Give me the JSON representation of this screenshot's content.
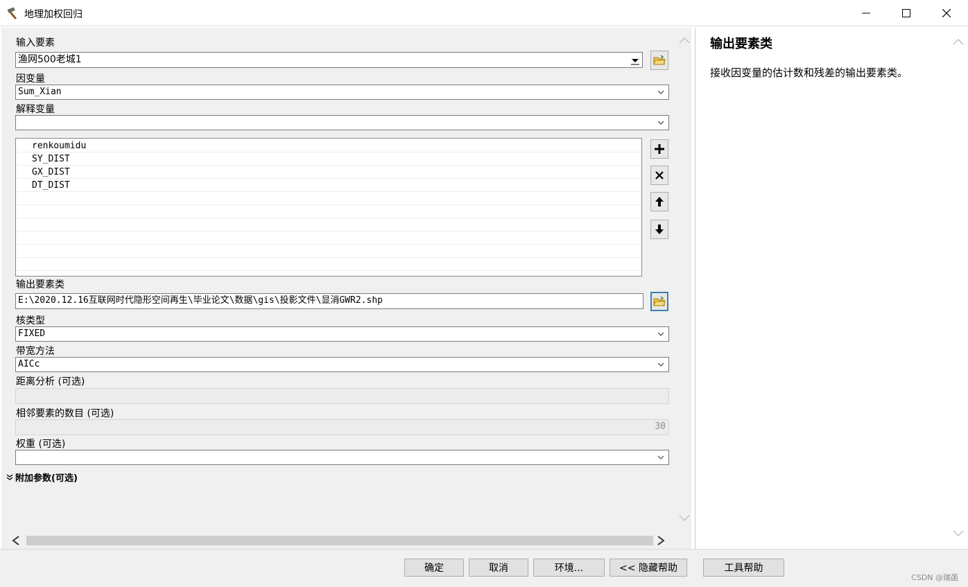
{
  "window": {
    "title": "地理加权回归"
  },
  "input_features": {
    "label": "输入要素",
    "value": "渔网500老城1"
  },
  "dependent_variable": {
    "label": "因变量",
    "value": "Sum_Xian"
  },
  "explanatory_variables": {
    "label": "解释变量",
    "value": "",
    "items": [
      "renkoumidu",
      "SY_DIST",
      "GX_DIST",
      "DT_DIST"
    ]
  },
  "output_features": {
    "label": "输出要素类",
    "value": "E:\\2020.12.16互联网时代隐形空间再生\\毕业论文\\数据\\gis\\投影文件\\显消GWR2.shp"
  },
  "kernel_type": {
    "label": "核类型",
    "value": "FIXED"
  },
  "bandwidth_method": {
    "label": "带宽方法",
    "value": "AICc"
  },
  "distance": {
    "label": "距离分析 (可选)",
    "value": ""
  },
  "neighbors": {
    "label": "相邻要素的数目 (可选)",
    "value": "30"
  },
  "weights": {
    "label": "权重 (可选)",
    "value": ""
  },
  "additional": {
    "label": "附加参数(可选)"
  },
  "help": {
    "title": "输出要素类",
    "description": "接收因变量的估计数和残差的输出要素类。"
  },
  "buttons": {
    "ok": "确定",
    "cancel": "取消",
    "environments": "环境...",
    "hide_help": "<< 隐藏帮助",
    "tool_help": "工具帮助"
  },
  "watermark": "CSDN @瑞菡",
  "icons": {
    "title": "hammer-icon",
    "add": "plus-icon",
    "remove": "x-icon",
    "up": "arrow-up-icon",
    "down": "arrow-down-icon",
    "browse": "folder-icon"
  },
  "colors": {
    "help_bg": "#ffffff",
    "pane_bg": "#f0f0f0",
    "focus_border": "#3c7fb1"
  }
}
